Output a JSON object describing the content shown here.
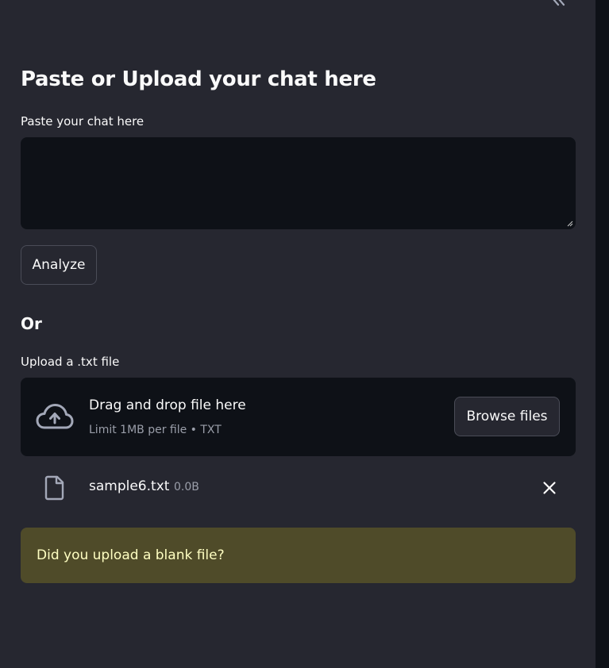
{
  "sidebar": {
    "collapse_icon": "double-chevron-left-icon"
  },
  "header": {
    "title": "Paste or Upload your chat here"
  },
  "paste": {
    "label": "Paste your chat here",
    "value": "",
    "analyze_label": "Analyze"
  },
  "or_heading": "Or",
  "upload": {
    "label": "Upload a .txt file",
    "dropzone_title": "Drag and drop file here",
    "dropzone_limit": "Limit 1MB per file • TXT",
    "browse_label": "Browse files",
    "icon": "cloud-upload-icon"
  },
  "uploaded_file": {
    "name": "sample6.txt",
    "size": "0.0B",
    "icon": "file-icon",
    "remove_icon": "close-icon"
  },
  "warning": {
    "text": "Did you upload a blank file?"
  },
  "colors": {
    "background": "#262730",
    "input_background": "#0e1117",
    "warning_background": "#4f4b29",
    "warning_text": "#ffffc2",
    "muted_text": "#9a9ea9"
  }
}
